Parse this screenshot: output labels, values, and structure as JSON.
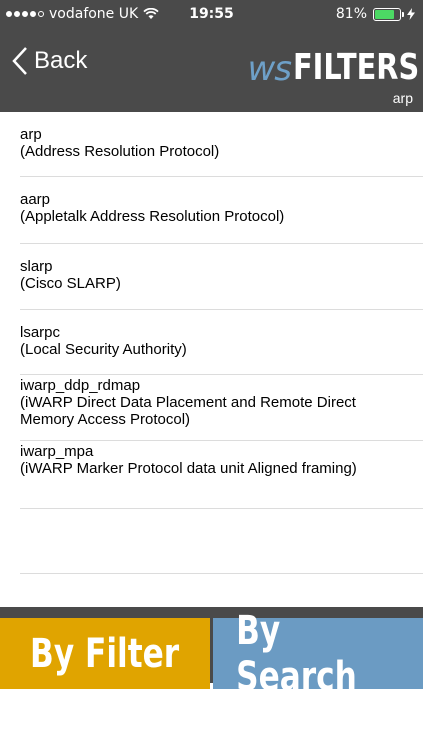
{
  "status": {
    "carrier": "vodafone UK",
    "time": "19:55",
    "battery": "81%",
    "battery_level": 0.81,
    "signal_bars": 4,
    "signal_total": 5
  },
  "nav": {
    "back_label": "Back",
    "logo_ws": "ws",
    "logo_filters": "FILTERS",
    "subtitle": "arp"
  },
  "filters": [
    {
      "name": "arp",
      "desc": "(Address Resolution Protocol)"
    },
    {
      "name": "aarp",
      "desc": "(Appletalk Address Resolution Protocol)"
    },
    {
      "name": "slarp",
      "desc": "(Cisco SLARP)"
    },
    {
      "name": "lsarpc",
      "desc": "(Local Security Authority)"
    },
    {
      "name": "iwarp_ddp_rdmap",
      "desc": "(iWARP Direct Data Placement and Remote Direct Memory Access Protocol)"
    },
    {
      "name": "iwarp_mpa",
      "desc": "(iWARP Marker Protocol data unit Aligned framing)"
    }
  ],
  "tabs": {
    "by_filter": "By Filter",
    "by_search": "By Search"
  },
  "colors": {
    "bar": "#4a4a4a",
    "filter_tab": "#e0a400",
    "search_tab": "#6b9bc3",
    "battery": "#4cd964",
    "logo_accent": "#6ea0c8"
  }
}
